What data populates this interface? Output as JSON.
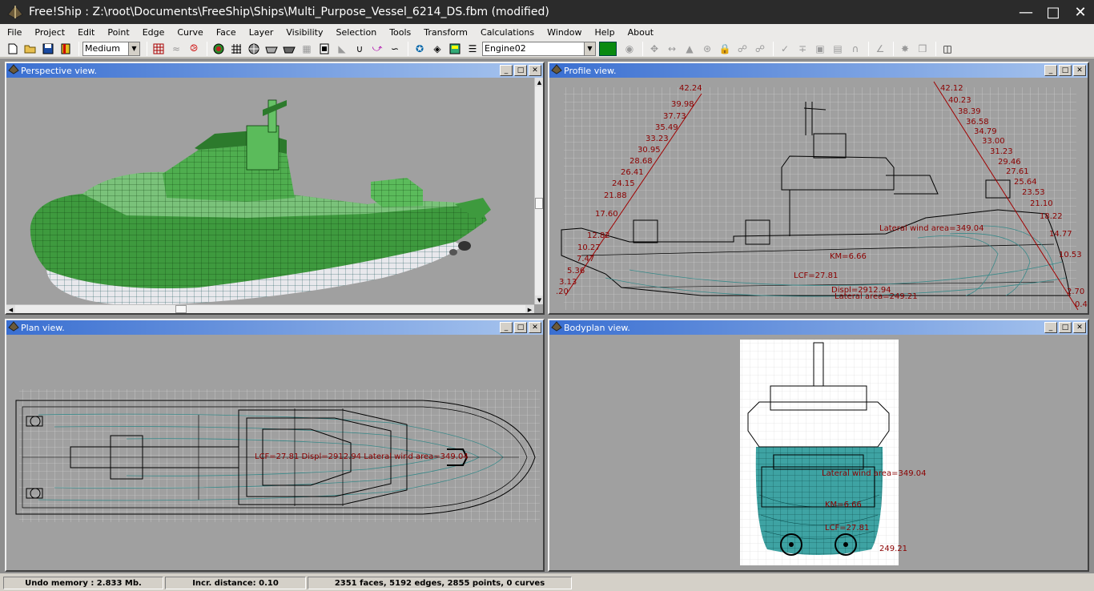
{
  "window": {
    "title": "Free!Ship  : Z:\\root\\Documents\\FreeShip\\Ships\\Multi_Purpose_Vessel_6214_DS.fbm (modified)"
  },
  "menu": [
    "File",
    "Project",
    "Edit",
    "Point",
    "Edge",
    "Curve",
    "Face",
    "Layer",
    "Visibility",
    "Selection",
    "Tools",
    "Transform",
    "Calculations",
    "Window",
    "Help",
    "About"
  ],
  "toolbar": {
    "precision_value": "Medium",
    "layer_value": "Engine02"
  },
  "views": {
    "perspective": {
      "title": "Perspective view."
    },
    "profile": {
      "title": "Profile view.",
      "labels": {
        "lateral_wind": "Lateral wind area=349.04",
        "km": "KM=6.66",
        "lcf": "LCF=27.81",
        "displ": "Displ=2912.94",
        "lateral_area": "Lateral area=249.21"
      },
      "left_scale": [
        "42.24",
        "39.98",
        "37.73",
        "35.49",
        "33.23",
        "30.95",
        "28.68",
        "26.41",
        "24.15",
        "21.88",
        "17.60",
        "12.82",
        "10.27",
        "7.47",
        "5.36",
        "3.13",
        ".20"
      ],
      "right_scale": [
        "42.12",
        "40.23",
        "38.39",
        "36.58",
        "34.79",
        "33.00",
        "31.23",
        "29.46",
        "27.61",
        "25.64",
        "23.53",
        "21.10",
        "18.22",
        "14.77",
        "10.53",
        "2.70",
        "0.4"
      ]
    },
    "plan": {
      "title": "Plan view.",
      "label": "LCF=27.81 Displ=2912.94 Lateral wind area=349.04"
    },
    "bodyplan": {
      "title": "Bodyplan view.",
      "labels": {
        "lateral_wind": "Lateral wind area=349.04",
        "km": "KM=6.66",
        "lcf": "LCF=27.81",
        "lateral_area": "249.21"
      }
    }
  },
  "status": {
    "undo": "Undo memory : 2.833 Mb.",
    "incr": "Incr. distance: 0.10",
    "counts": "2351 faces, 5192 edges, 2855 points, 0 curves"
  }
}
